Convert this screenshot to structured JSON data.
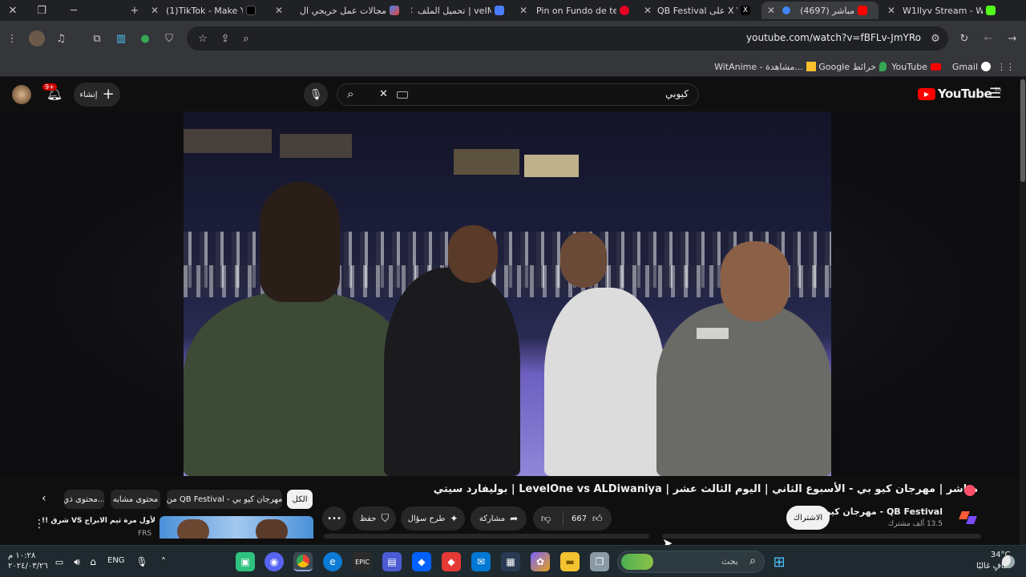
{
  "browser": {
    "tabs": [
      {
        "title": "(1)TikTok - Make You",
        "active": false
      },
      {
        "title": "مجالات عمل خريجي ال",
        "active": false
      },
      {
        "title": "تحميل الملف | veIMG",
        "active": false
      },
      {
        "title": "Pin on Fundo de tela",
        "active": false
      },
      {
        "title": "QB Festival على X \\ X",
        "active": false
      },
      {
        "title": "مباشر (4697)",
        "active": true
      },
      {
        "title": "W1llyv Stream - Wat",
        "active": false
      }
    ],
    "new_tab_glyph": "+",
    "address": "youtube.com/watch?v=fBFLv-JmYRo",
    "bookmarks": [
      {
        "label": "Gmail",
        "icon": "google-icon"
      },
      {
        "label": "YouTube",
        "icon": "youtube-icon"
      },
      {
        "label": "Google خرائط",
        "icon": "maps-icon"
      },
      {
        "label": "WitAnime - مشاهدة...",
        "icon": "witanime-icon"
      }
    ]
  },
  "youtube": {
    "logo_text": "YouTube",
    "region": "SA",
    "search_value": "كيوبي",
    "create_label": "إنشاء",
    "notif_badge": "9+",
    "video_title": "مباشر | مهرجان كيو بي - الأسبوع الثاني | اليوم الثالث عشر | LevelOne vs ALDiwaniya | بوليفارد سيتي",
    "channel_name": "QB Festival - مهرجان كيو بي",
    "subscribers": "13.5 ألف مشترك",
    "subscribe_label": "الاشتراك",
    "like_count": "667",
    "share_label": "مشاركة",
    "ask_label": "طرح سؤال",
    "save_label": "حفظ",
    "chips": [
      "الكل",
      "من QB Festival - مهرجان كيو بي",
      "محتوى مشابه",
      "محتوى ذي..."
    ],
    "related": {
      "title": "لأول مرة ثيم الابراج VS شرق !!",
      "channel": "FRS"
    }
  },
  "taskbar": {
    "weather_temp": "34°C",
    "weather_desc": "صافٍ غالبًا",
    "search_placeholder": "بحث",
    "lang": "ENG",
    "time": "١٠:٢٨ م",
    "date": "٢٠٢٤/٠٣/٢٦"
  },
  "colors": {
    "accent_red": "#ff0000",
    "chrome_dark": "#202124",
    "chrome_toolbar": "#35363a",
    "yt_bg": "#0f0f0f"
  }
}
